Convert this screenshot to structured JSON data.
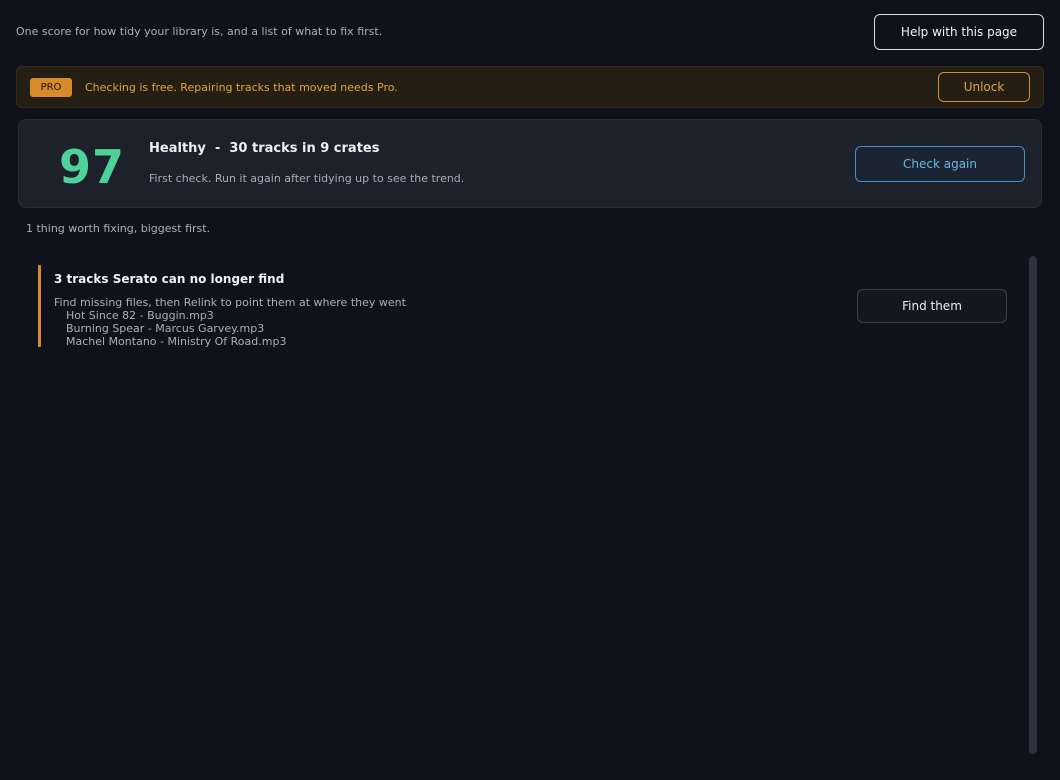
{
  "header": {
    "subtitle": "One score for how tidy your library is, and a list of what to fix first.",
    "help_label": "Help with this page"
  },
  "pro_banner": {
    "badge": "PRO",
    "message": "Checking is free. Repairing tracks that moved needs Pro.",
    "unlock_label": "Unlock"
  },
  "score_card": {
    "score": "97",
    "headline": "Healthy  -  30 tracks in 9 crates",
    "note": "First check. Run it again after tidying up to see the trend.",
    "check_label": "Check again"
  },
  "fix_summary": "1 thing worth fixing, biggest first.",
  "issues": [
    {
      "title": "3 tracks Serato can no longer find",
      "description": "Find missing files, then Relink to point them at where they went",
      "tracks": [
        "Hot Since 82 - Buggin.mp3",
        "Burning Spear - Marcus Garvey.mp3",
        "Machel Montano - Ministry Of Road.mp3"
      ],
      "action_label": "Find them"
    }
  ],
  "colors": {
    "background": "#0f121a",
    "score": "#4fd29a",
    "warning": "#d8892a",
    "accent_blue": "#6fb4e6"
  }
}
